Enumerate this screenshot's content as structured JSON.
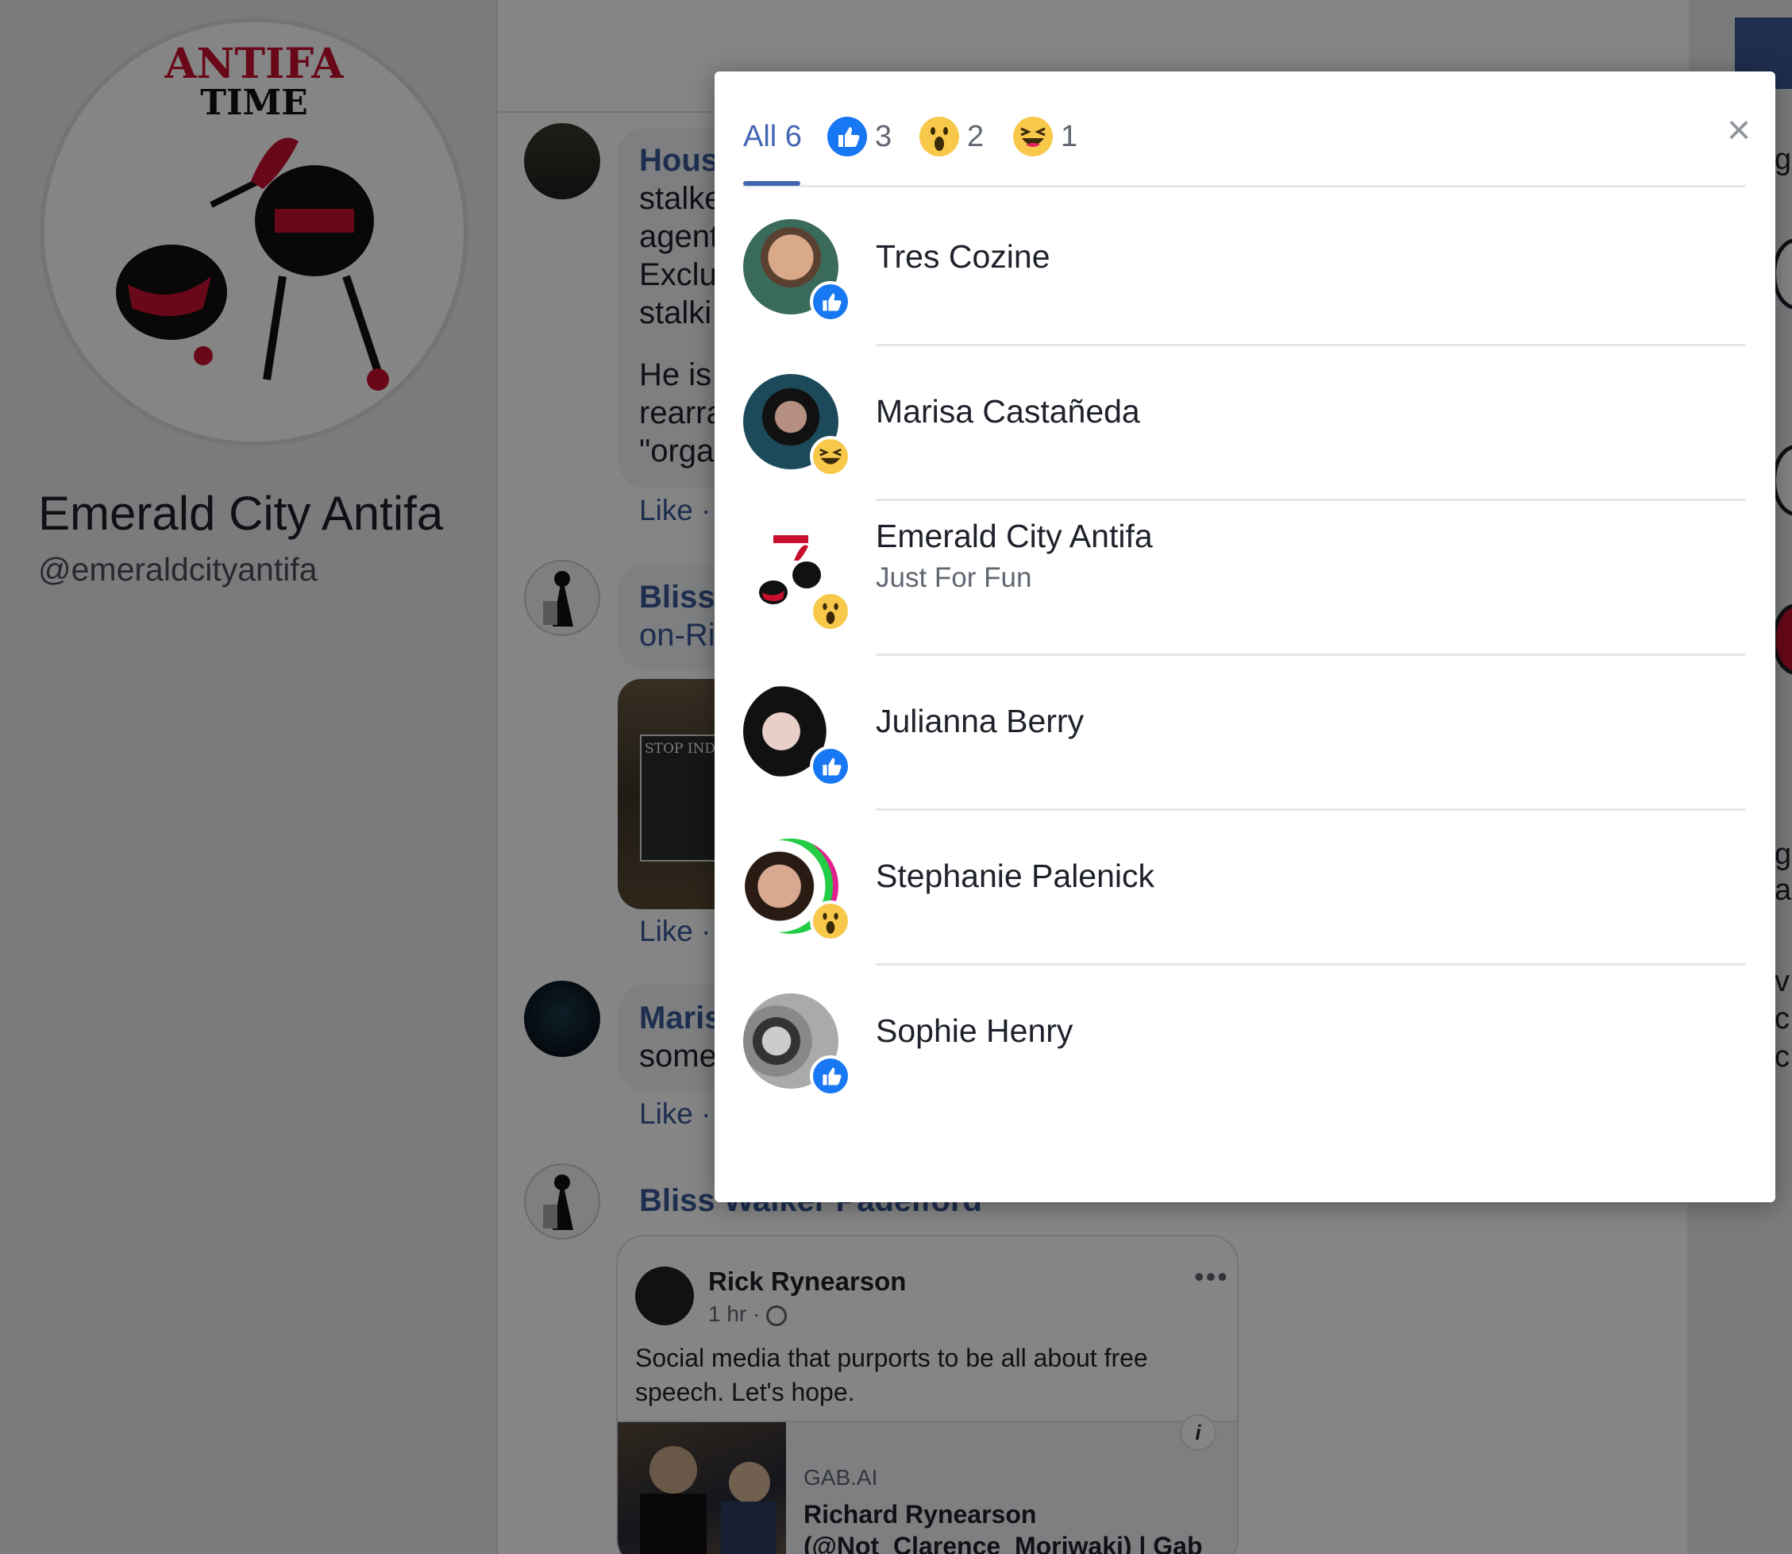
{
  "profile": {
    "name": "Emerald City Antifa",
    "handle": "@emeraldcityantifa",
    "logo_text_top": "ANTIFA",
    "logo_text_bottom": "TIME"
  },
  "feed": {
    "comments": [
      {
        "name": "Hous",
        "lines": [
          "stalke",
          "agent",
          "Exclu",
          "stalki",
          "He is",
          "rearra",
          "\"orga"
        ],
        "like": "Like ·"
      },
      {
        "name": "Bliss",
        "lines": [
          "on-Ri"
        ],
        "like": "Like ·"
      },
      {
        "name": "Maris",
        "lines": [
          "some"
        ],
        "like": "Like ·"
      },
      {
        "name": "Bliss Walker Padelford",
        "lines": [],
        "like": ""
      }
    ],
    "image_sign_text": "STOP INDEF",
    "shared_post": {
      "author": "Rick Rynearson",
      "time": "1 hr ·",
      "more": "•••",
      "text": "Social media that purports to be all about free speech.  Let's hope.",
      "link_domain": "GAB.AI",
      "link_title": "Richard Rynearson (@Not_Clarence_Moriwaki) | Gab",
      "info": "i"
    },
    "right_fragments": [
      "g",
      "g",
      "ar",
      "v",
      "c",
      "c"
    ]
  },
  "reactions_modal": {
    "tabs": [
      {
        "label": "All 6",
        "icon": ""
      },
      {
        "label": "3",
        "icon": "like-icon"
      },
      {
        "label": "2",
        "icon": "wow-icon"
      },
      {
        "label": "1",
        "icon": "haha-icon"
      }
    ],
    "close": "×",
    "people": [
      {
        "name": "Tres Cozine",
        "sub": "",
        "reaction": "like-icon"
      },
      {
        "name": "Marisa Castañeda",
        "sub": "",
        "reaction": "haha-icon"
      },
      {
        "name": "Emerald City Antifa",
        "sub": "Just For Fun",
        "reaction": "wow-icon"
      },
      {
        "name": "Julianna Berry",
        "sub": "",
        "reaction": "like-icon"
      },
      {
        "name": "Stephanie Palenick",
        "sub": "",
        "reaction": "wow-icon"
      },
      {
        "name": "Sophie Henry",
        "sub": "",
        "reaction": "like-icon"
      }
    ],
    "colors": {
      "accent": "#4267b2",
      "like": "#1877f2",
      "emoji": "#f7c84a"
    }
  }
}
